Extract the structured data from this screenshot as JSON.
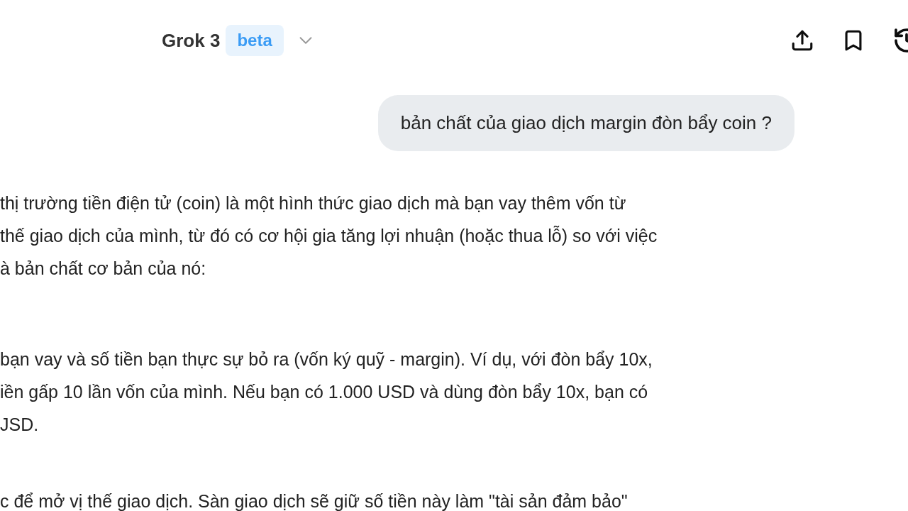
{
  "header": {
    "model": "Grok 3",
    "badge": "beta"
  },
  "user_message": "bản chất của giao dịch margin đòn bẩy coin ?",
  "paragraphs": [
    {
      "lines": [
        "thị trường tiền điện tử (coin) là một hình thức giao dịch mà bạn vay thêm vốn từ",
        "thế giao dịch của mình, từ đó có cơ hội gia tăng lợi nhuận (hoặc thua lỗ) so với việc",
        "à bản chất cơ bản của nó:"
      ]
    },
    {
      "lines": [
        "bạn vay và số tiền bạn thực sự bỏ ra (vốn ký quỹ - margin). Ví dụ, với đòn bẩy 10x,",
        "iền gấp 10 lần vốn của mình. Nếu bạn có 1.000 USD và dùng đòn bẩy 10x, bạn có",
        "JSD."
      ]
    },
    {
      "lines": [
        "c để mở vị thế giao dịch. Sàn giao dịch sẽ giữ số tiền này làm \"tài sản đảm bảo\""
      ]
    }
  ]
}
